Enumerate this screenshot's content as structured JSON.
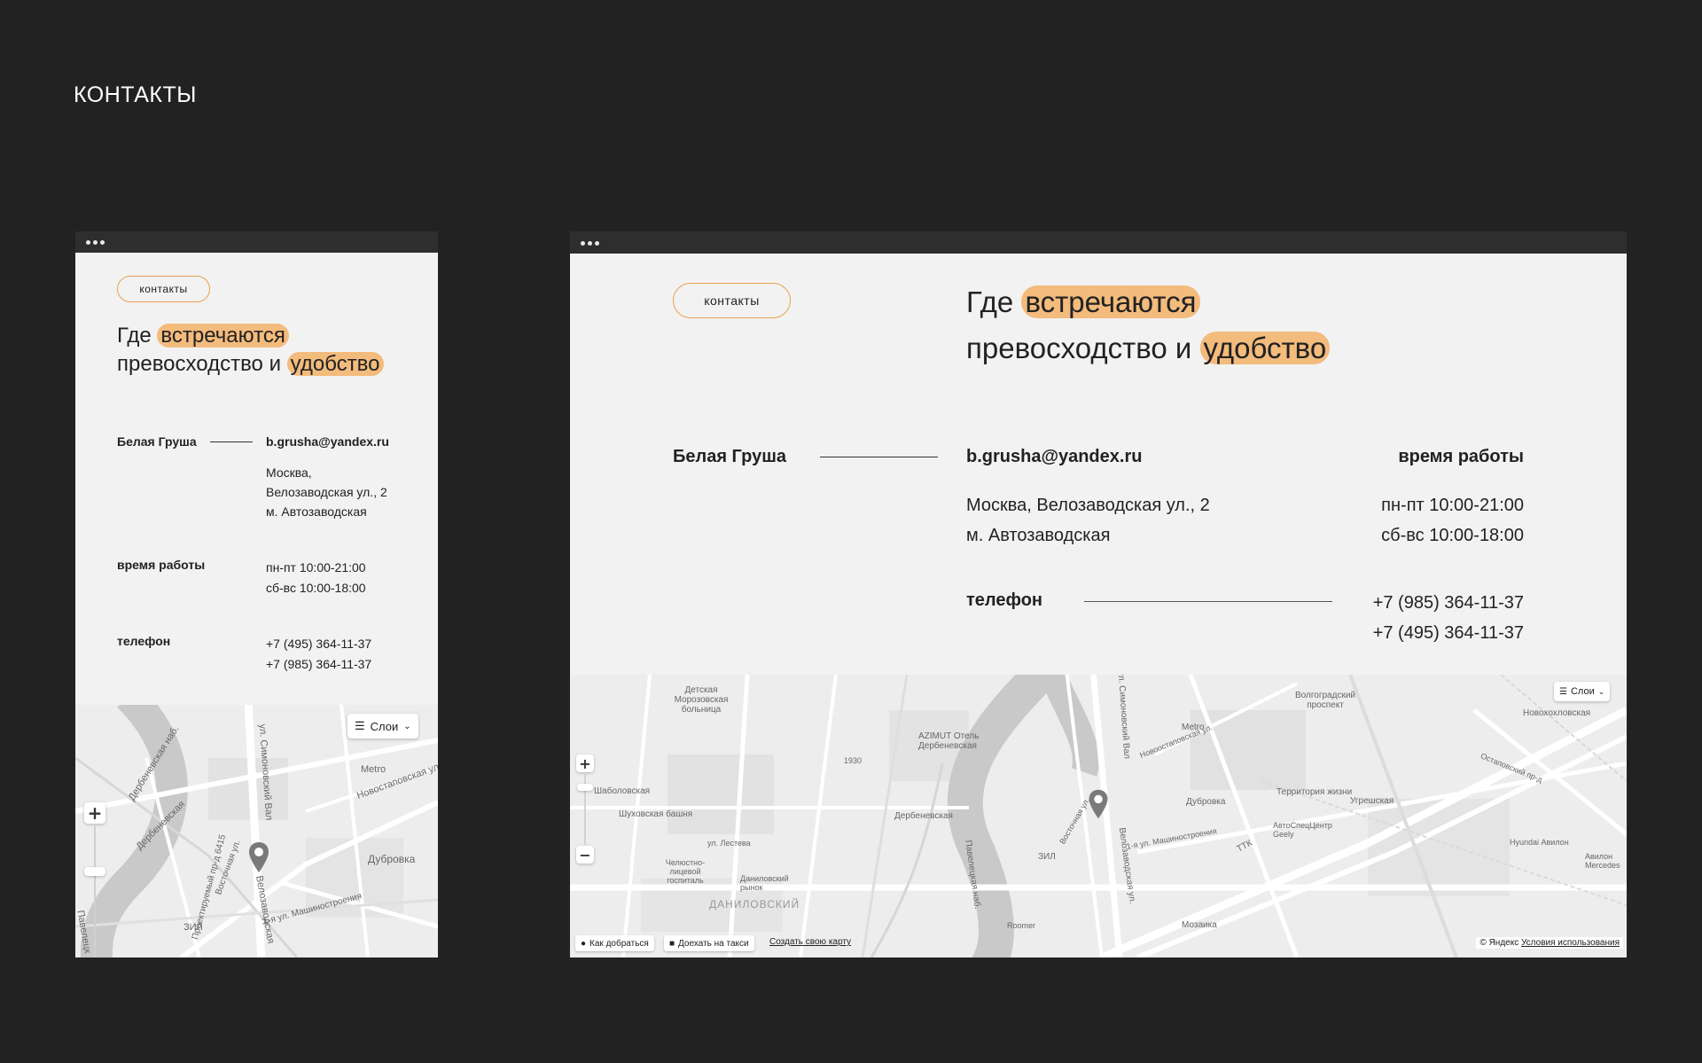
{
  "page": {
    "title": "КОНТАКТЫ"
  },
  "contacts": {
    "badge": "контакты",
    "headline": {
      "word1": "Где ",
      "highlight1": "встречаются",
      "word2": "превосходство и ",
      "highlight2": "удобство"
    },
    "company": "Белая Груша",
    "email": "b.grusha@yandex.ru",
    "address": {
      "city": "Москва,",
      "street": "Велозаводская ул., 2",
      "city_street": "Москва, Велозаводская ул., 2",
      "metro": "м. Автозаводская"
    },
    "hours": {
      "label": "время работы",
      "weekdays": "пн-пт 10:00-21:00",
      "weekend": "сб-вс 10:00-18:00"
    },
    "phone": {
      "label": "телефон",
      "number1": "+7 (495) 364-11-37",
      "number2": "+7 (985) 364-11-37"
    }
  },
  "map": {
    "layers_label": "Слои",
    "zoom_in": "+",
    "zoom_out": "−",
    "route_button": "Как добраться",
    "taxi_button": "Доехать на такси",
    "create_map_link": "Создать свою карту",
    "copyright": "© Яндекс",
    "terms_link": "Условия использования",
    "labels_mobile": [
      "Дербеневская наб.",
      "ул. Симоновский Вал",
      "Новостаповская ул.",
      "Metro",
      "Дубровка",
      "ЗИЛ",
      "Восточная ул.",
      "Велозаводская",
      "1-я ул. Машиностроения",
      "Проектируемый пр-д 6415",
      "Дербеневская",
      "Павелецк"
    ],
    "labels_desktop": [
      "Детская Морозовская больница",
      "AZIMUT Отель Дербеневская",
      "ул. Симоновский Вал",
      "Metro",
      "Волгоградский проспект",
      "Новохохловская",
      "Шаболовская",
      "Шуховская башня",
      "ул. Лестева",
      "Челюстно-лицевой госпиталь",
      "Даниловский рынок",
      "ДАНИЛОВСКИЙ",
      "Дербеневская",
      "Павелецкая наб.",
      "ЗИЛ",
      "Дубровка",
      "Территория жизни",
      "АвтоСпецЦентр Geely",
      "Угрешская",
      "ТТК",
      "Hyundai Авилон",
      "Авилон Mercedes",
      "Мозаика",
      "Roomer",
      "1930",
      "Новоостаповская ул.",
      "Остаповский пр-д",
      "1-я ул. Машиностроения",
      "Велозаводская ул.",
      "Восточная ул."
    ]
  }
}
